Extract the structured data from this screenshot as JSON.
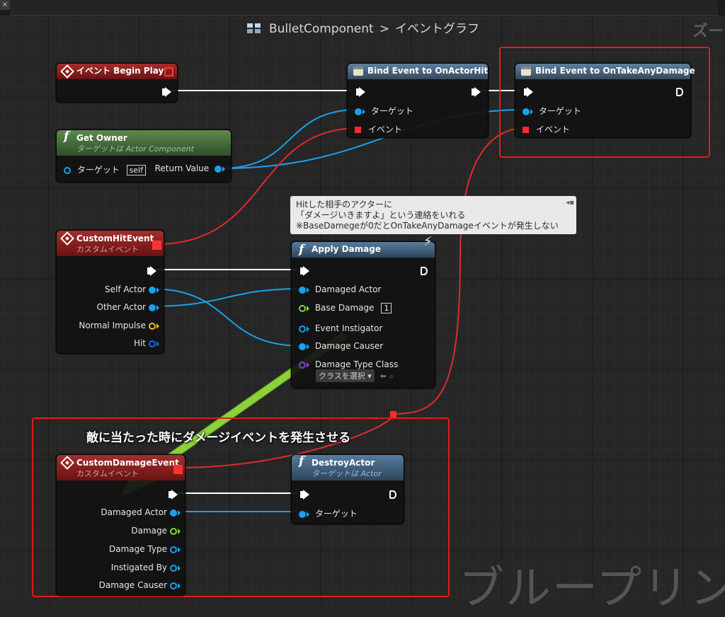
{
  "window": {
    "close_glyph": "×"
  },
  "breadcrumb": {
    "asset": "BulletComponent",
    "separator": ">",
    "graph": "イベントグラフ"
  },
  "zoom_label": "ズー",
  "watermark": "ブループリン",
  "nodes": {
    "begin_play": {
      "title": "イベント Begin Play"
    },
    "get_owner": {
      "title": "Get Owner",
      "subtitle": "ターゲットは Actor Component",
      "target_label": "ターゲット",
      "self_value": "self",
      "return_label": "Return Value"
    },
    "bind_actor_hit": {
      "title": "Bind Event to OnActorHit",
      "target_label": "ターゲット",
      "event_label": "イベント"
    },
    "bind_take_damage": {
      "title": "Bind Event to OnTakeAnyDamage",
      "target_label": "ターゲット",
      "event_label": "イベント"
    },
    "custom_hit_event": {
      "title": "CustomHitEvent",
      "subtitle": "カスタムイベント",
      "pins": [
        "Self Actor",
        "Other Actor",
        "Normal Impulse",
        "Hit"
      ]
    },
    "apply_damage": {
      "title": "Apply Damage",
      "pins": {
        "damaged_actor": "Damaged Actor",
        "base_damage": "Base Damage",
        "base_damage_value": "1",
        "event_instigator": "Event Instigator",
        "damage_causer": "Damage Causer",
        "damage_type_class": "Damage Type Class",
        "class_select": "クラスを選択"
      }
    },
    "custom_damage_event": {
      "title": "CustomDamageEvent",
      "subtitle": "カスタムイベント",
      "pins": [
        "Damaged Actor",
        "Damage",
        "Damage Type",
        "Instigated By",
        "Damage Causer"
      ]
    },
    "destroy_actor": {
      "title": "DestroyActor",
      "subtitle": "ターゲットは Actor",
      "target_label": "ターゲット"
    }
  },
  "comment": {
    "lines": [
      "Hitした相手のアクターに",
      "「ダメージいきますよ」という連絡をいれる",
      "※BaseDamegeが0だとOnTakeAnyDamageイベントが発生しない"
    ]
  },
  "annotation": "敵に当たった時にダメージイベントを発生させる",
  "colors": {
    "exec": "#ffffff",
    "object": "#1aa0ec",
    "delegate": "#ff2b2b",
    "float": "#7fd63b",
    "vector": "#e6c214",
    "highlight": "#e21b1b",
    "arrow": "#8cd23a"
  }
}
